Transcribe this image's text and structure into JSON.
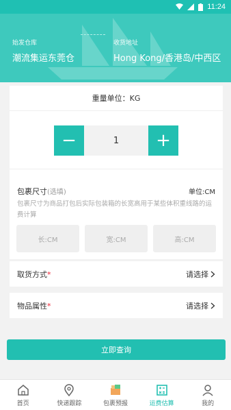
{
  "status_bar": {
    "time": "11:24"
  },
  "header": {
    "origin_label": "始发仓库",
    "origin_value": "潮流集运东莞仓",
    "dest_label": "收货地址",
    "dest_value": "Hong Kong/香港岛/中西区"
  },
  "weight": {
    "unit_label": "重量单位：KG",
    "value": "1",
    "minus": "−",
    "plus": "+"
  },
  "dimensions": {
    "title": "包裹尺寸",
    "optional": "(选填)",
    "unit": "单位:CM",
    "description": "包裹尺寸为商品打包后实际包装箱的长宽高用于某些体积重线路的运费计算",
    "length_placeholder": "长:CM",
    "width_placeholder": "宽:CM",
    "height_placeholder": "高:CM"
  },
  "pickup": {
    "label": "取货方式",
    "required_mark": "*",
    "select": "请选择"
  },
  "attribute": {
    "label": "物品属性",
    "required_mark": "*",
    "select": "请选择"
  },
  "query_button": "立即查询",
  "tabs": [
    {
      "label": "首页",
      "icon": "home-icon"
    },
    {
      "label": "快递跟踪",
      "icon": "location-pin-icon"
    },
    {
      "label": "包裹预报",
      "icon": "package-icon"
    },
    {
      "label": "运费估算",
      "icon": "calculator-icon",
      "active": true
    },
    {
      "label": "我的",
      "icon": "user-icon"
    }
  ],
  "colors": {
    "accent": "#22bfb1",
    "header": "#3ec9bd"
  }
}
